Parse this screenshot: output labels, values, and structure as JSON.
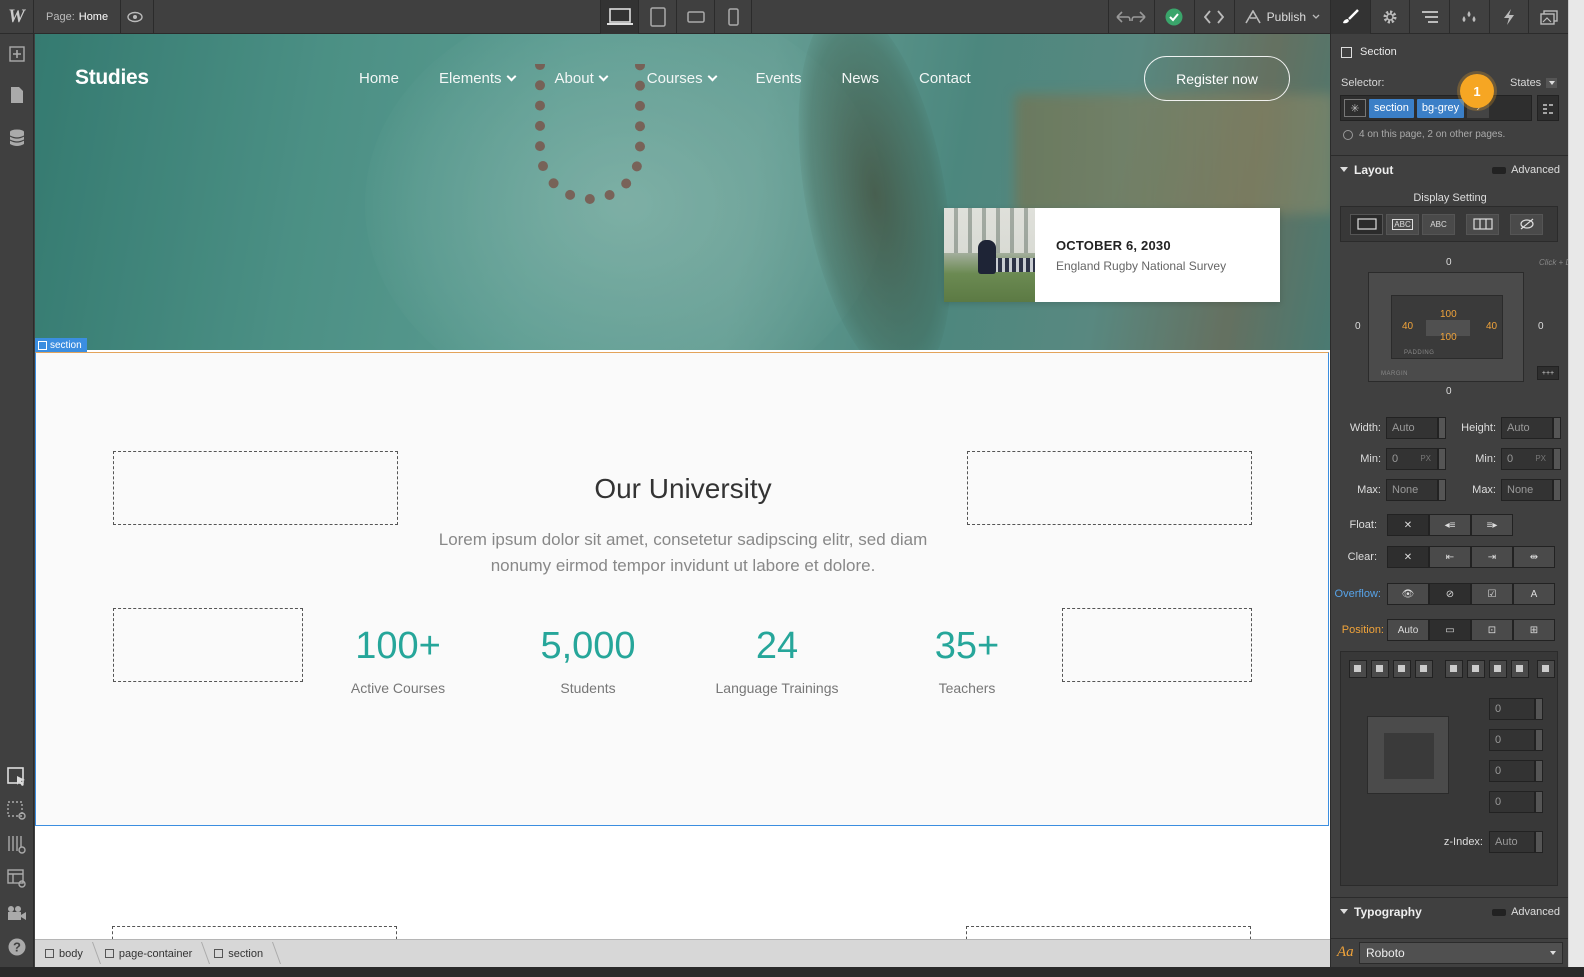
{
  "topbar": {
    "logo": "W",
    "page_label": "Page:",
    "page_value": "Home",
    "publish_label": "Publish"
  },
  "site": {
    "brand": "Studies",
    "nav": [
      {
        "label": "Home",
        "active": true,
        "dropdown": false
      },
      {
        "label": "Elements",
        "active": false,
        "dropdown": true
      },
      {
        "label": "About",
        "active": false,
        "dropdown": true
      },
      {
        "label": "Courses",
        "active": false,
        "dropdown": true
      },
      {
        "label": "Events",
        "active": false,
        "dropdown": false
      },
      {
        "label": "News",
        "active": false,
        "dropdown": false
      },
      {
        "label": "Contact",
        "active": false,
        "dropdown": false
      }
    ],
    "register_label": "Register now",
    "event": {
      "date": "OCTOBER 6, 2030",
      "title": "England Rugby National Survey"
    },
    "selected_tag": "section",
    "about": {
      "title": "Our University",
      "description": "Lorem ipsum dolor sit amet, consetetur sadipscing elitr, sed diam nonumy eirmod tempor invidunt ut labore et dolore."
    },
    "stats": [
      {
        "value": "100+",
        "label": "Active Courses"
      },
      {
        "value": "5,000",
        "label": "Students"
      },
      {
        "value": "24",
        "label": "Language Trainings"
      },
      {
        "value": "35+",
        "label": "Teachers"
      }
    ]
  },
  "breadcrumb": [
    "body",
    "page-container",
    "section"
  ],
  "panel": {
    "element_type": "Section",
    "selector_label": "Selector:",
    "states_label": "States",
    "selector_classes": [
      "section",
      "bg-grey"
    ],
    "badge_number": "1",
    "usage_text": "4 on this page, 2 on other pages.",
    "layout_title": "Layout",
    "advanced_label": "Advanced",
    "display_setting_label": "Display Setting",
    "display_options": [
      "ABC",
      "ABC"
    ],
    "box_model": {
      "margin_top": "0",
      "margin_bottom": "0",
      "margin_left": "0",
      "margin_right": "0",
      "padding_top": "100",
      "padding_bottom": "100",
      "padding_left": "40",
      "padding_right": "40",
      "padding_tag": "PADDING",
      "margin_tag": "MARGIN",
      "hint": "Click + Drag"
    },
    "width_label": "Width:",
    "width_value": "Auto",
    "height_label": "Height:",
    "height_value": "Auto",
    "min_label": "Min:",
    "min_w_value": "0",
    "min_h_value": "0",
    "unit_px": "PX",
    "max_label": "Max:",
    "max_w_value": "None",
    "max_h_value": "None",
    "float_label": "Float:",
    "clear_label": "Clear:",
    "overflow_label": "Overflow:",
    "position_label": "Position:",
    "position_auto": "Auto",
    "offsets": [
      "0",
      "0",
      "0",
      "0"
    ],
    "zindex_label": "z-Index:",
    "zindex_value": "Auto",
    "typography_title": "Typography",
    "font_value": "Roboto",
    "font_icon": "Aa"
  }
}
